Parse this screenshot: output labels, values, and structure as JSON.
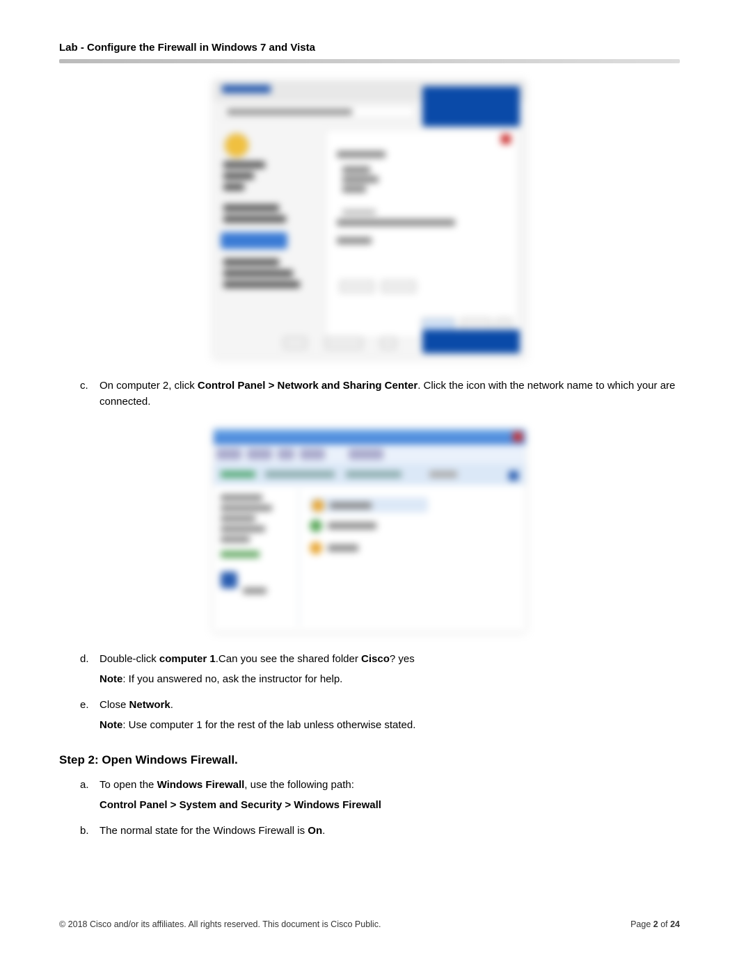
{
  "header": {
    "title": "Lab - Configure the Firewall in Windows 7 and Vista"
  },
  "items": {
    "c": {
      "marker": "c.",
      "pre": "On computer 2, click ",
      "bold": "Control Panel > Network and Sharing Center",
      "post": ". Click the icon with the network name to which your are connected."
    },
    "d": {
      "marker": "d.",
      "line1_pre": "Double-click ",
      "line1_b1": "computer 1",
      "line1_mid": ".Can you see the shared folder ",
      "line1_b2": "Cisco",
      "line1_post": "? yes",
      "line2_b": "Note",
      "line2_post": ": If you answered no, ask the instructor for help."
    },
    "e": {
      "marker": "e.",
      "line1_pre": "Close ",
      "line1_b": "Network",
      "line1_post": ".",
      "line2_b": "Note",
      "line2_post": ": Use computer 1 for the rest of the lab unless otherwise stated."
    }
  },
  "step2": {
    "heading": "Step 2: Open Windows Firewall.",
    "a": {
      "marker": "a.",
      "line1_pre": "To open the ",
      "line1_b": "Windows Firewall",
      "line1_post": ", use the following path:",
      "line2": "Control Panel > System and Security > Windows Firewall"
    },
    "b": {
      "marker": "b.",
      "pre": "The normal state for the Windows Firewall is ",
      "b": "On",
      "post": "."
    }
  },
  "footer": {
    "copyright": "© 2018 Cisco and/or its affiliates. All rights reserved. This document is Cisco Public.",
    "page_pre": "Page ",
    "page_num": "2",
    "page_mid": " of ",
    "page_total": "24"
  }
}
